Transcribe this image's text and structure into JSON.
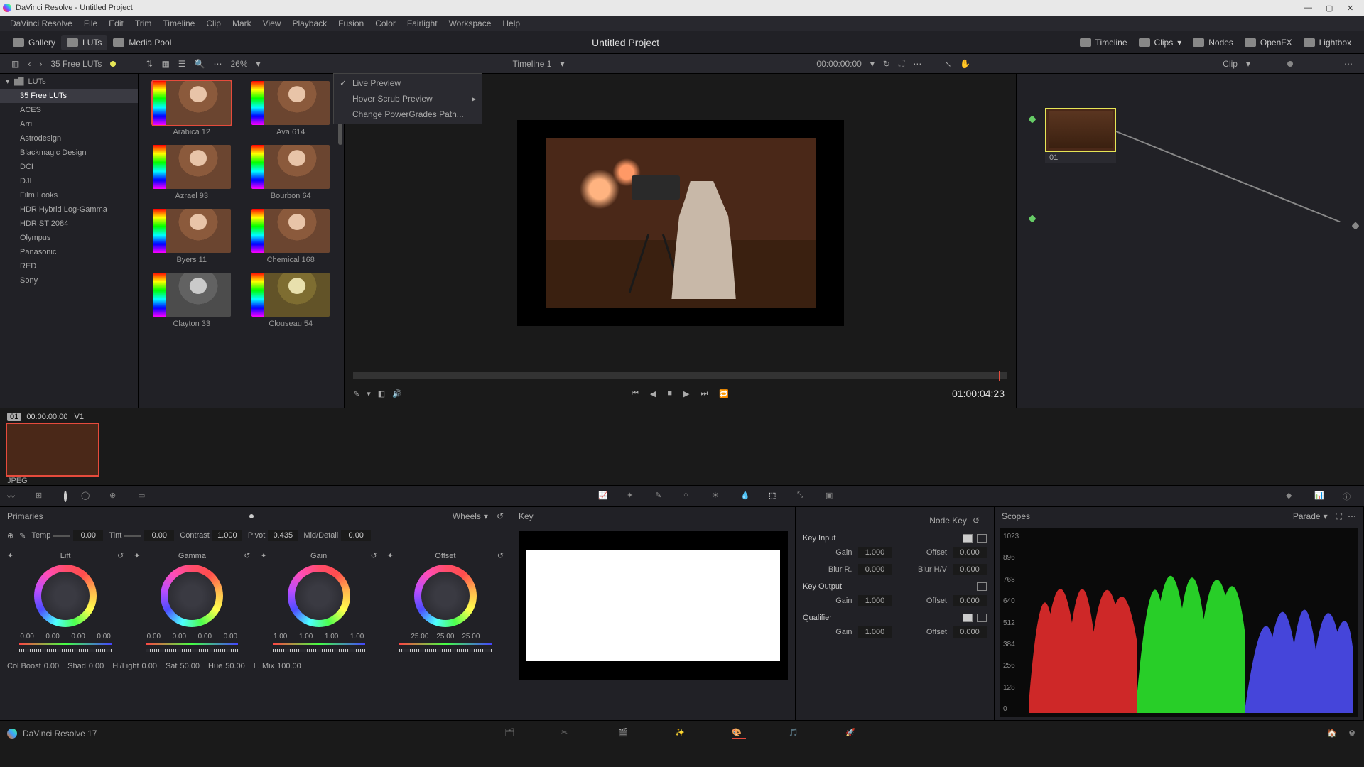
{
  "titlebar": {
    "title": "DaVinci Resolve - Untitled Project"
  },
  "menu": [
    "DaVinci Resolve",
    "File",
    "Edit",
    "Trim",
    "Timeline",
    "Clip",
    "Mark",
    "View",
    "Playback",
    "Fusion",
    "Color",
    "Fairlight",
    "Workspace",
    "Help"
  ],
  "toolbar": {
    "gallery": "Gallery",
    "luts": "LUTs",
    "media_pool": "Media Pool",
    "project": "Untitled Project",
    "timeline_btn": "Timeline",
    "clips": "Clips",
    "nodes": "Nodes",
    "openfx": "OpenFX",
    "lightbox": "Lightbox"
  },
  "secbar": {
    "breadcrumb": "35 Free LUTs",
    "zoom": "26%",
    "timeline_name": "Timeline 1",
    "timecode": "00:00:00:00",
    "clip_label": "Clip"
  },
  "lut_tree": {
    "root": "LUTs",
    "items": [
      "35 Free LUTs",
      "ACES",
      "Arri",
      "Astrodesign",
      "Blackmagic Design",
      "DCI",
      "DJI",
      "Film Looks",
      "HDR Hybrid Log-Gamma",
      "HDR ST 2084",
      "Olympus",
      "Panasonic",
      "RED",
      "Sony"
    ]
  },
  "lut_grid": [
    {
      "label": "Arabica 12",
      "sel": true
    },
    {
      "label": "Ava 614"
    },
    {
      "label": "Azrael 93"
    },
    {
      "label": "Bourbon 64"
    },
    {
      "label": "Byers 11"
    },
    {
      "label": "Chemical 168"
    },
    {
      "label": "Clayton 33",
      "bw": true
    },
    {
      "label": "Clouseau 54",
      "cool": true
    }
  ],
  "ctxmenu": {
    "live": "Live Preview",
    "hover": "Hover Scrub Preview",
    "change": "Change PowerGrades Path..."
  },
  "viewer": {
    "timecode": "01:00:04:23"
  },
  "node": {
    "label": "01"
  },
  "clip": {
    "num": "01",
    "tc": "00:00:00:00",
    "track": "V1",
    "type": "JPEG"
  },
  "primaries": {
    "title": "Primaries",
    "mode": "Wheels",
    "temp_l": "Temp",
    "temp": "0.00",
    "tint_l": "Tint",
    "tint": "0.00",
    "contrast_l": "Contrast",
    "contrast": "1.000",
    "pivot_l": "Pivot",
    "pivot": "0.435",
    "md_l": "Mid/Detail",
    "md": "0.00",
    "wheels": [
      {
        "name": "Lift",
        "vals": [
          "0.00",
          "0.00",
          "0.00",
          "0.00"
        ]
      },
      {
        "name": "Gamma",
        "vals": [
          "0.00",
          "0.00",
          "0.00",
          "0.00"
        ]
      },
      {
        "name": "Gain",
        "vals": [
          "1.00",
          "1.00",
          "1.00",
          "1.00"
        ]
      },
      {
        "name": "Offset",
        "vals": [
          "25.00",
          "25.00",
          "25.00"
        ]
      }
    ],
    "colboost_l": "Col Boost",
    "colboost": "0.00",
    "shad_l": "Shad",
    "shad": "0.00",
    "hilight_l": "Hi/Light",
    "hilight": "0.00",
    "sat_l": "Sat",
    "sat": "50.00",
    "hue_l": "Hue",
    "hue": "50.00",
    "lmix_l": "L. Mix",
    "lmix": "100.00"
  },
  "key": {
    "title": "Key",
    "nodekey": "Node Key",
    "input": "Key Input",
    "gain_l": "Gain",
    "gain1": "1.000",
    "offset_l": "Offset",
    "offset1": "0.000",
    "blurr_l": "Blur R.",
    "blurr": "0.000",
    "blurhv_l": "Blur H/V",
    "blurhv": "0.000",
    "output": "Key Output",
    "gain2": "1.000",
    "offset2": "0.000",
    "qualifier": "Qualifier",
    "gain3": "1.000",
    "offset3": "0.000"
  },
  "scopes": {
    "title": "Scopes",
    "mode": "Parade",
    "levels": [
      "1023",
      "896",
      "768",
      "640",
      "512",
      "384",
      "256",
      "128",
      "0"
    ]
  },
  "pagenav": {
    "app": "DaVinci Resolve 17"
  }
}
